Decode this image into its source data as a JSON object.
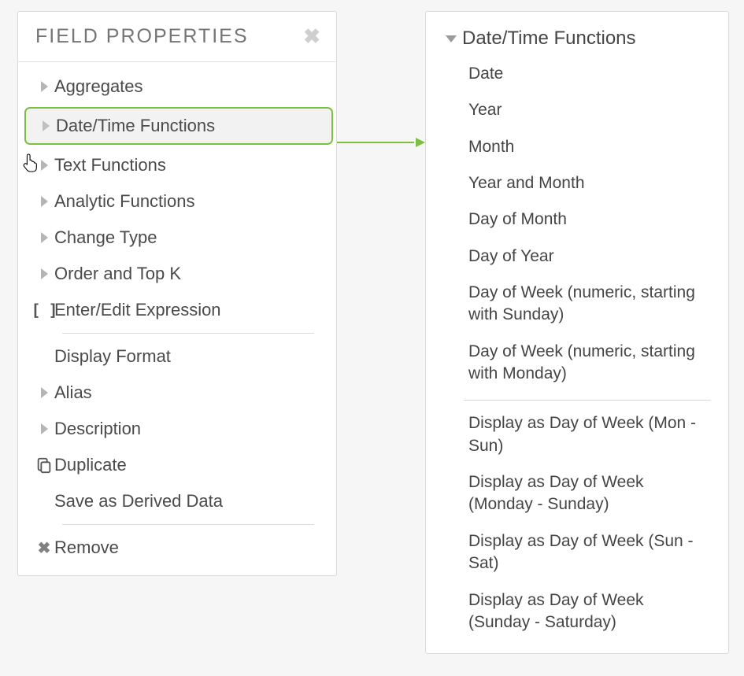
{
  "header": {
    "title": "FIELD PROPERTIES"
  },
  "menu": {
    "aggregates": "Aggregates",
    "datetime": "Date/Time Functions",
    "textfn": "Text Functions",
    "analytic": "Analytic Functions",
    "changetype": "Change Type",
    "ordertopk": "Order and Top K",
    "expr": "Enter/Edit Expression",
    "dispformat": "Display Format",
    "alias": "Alias",
    "description": "Description",
    "duplicate": "Duplicate",
    "savederived": "Save as Derived Data",
    "remove": "Remove"
  },
  "submenu": {
    "title": "Date/Time Functions",
    "items1": [
      "Date",
      "Year",
      "Month",
      "Year and Month",
      "Day of Month",
      "Day of Year",
      "Day of Week (numeric, starting with Sunday)",
      "Day of Week (numeric, starting with Monday)"
    ],
    "items2": [
      "Display as Day of Week (Mon - Sun)",
      "Display as Day of Week (Monday - Sunday)",
      "Display as Day of Week (Sun - Sat)",
      "Display as Day of Week (Sunday - Saturday)"
    ]
  },
  "selected_menu_key": "datetime"
}
